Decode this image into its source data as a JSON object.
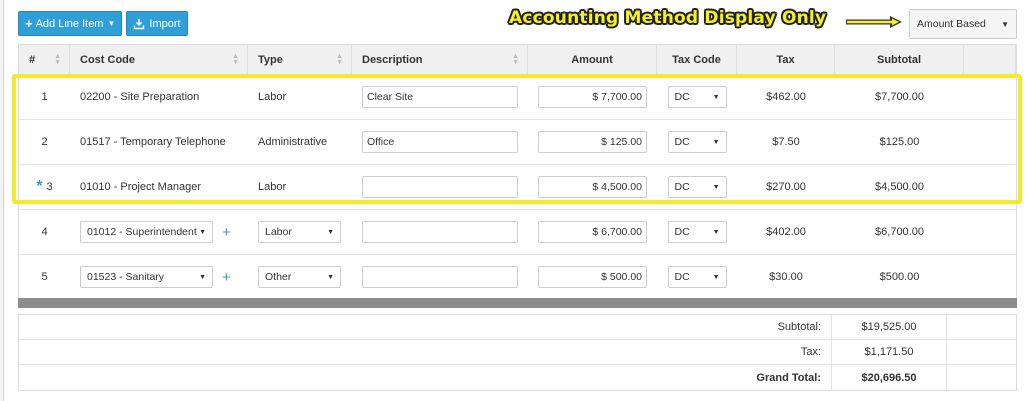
{
  "toolbar": {
    "add_line_item": "Add Line Item",
    "import": "Import"
  },
  "callout": {
    "text": "Accounting Method Display Only",
    "color": "#f5f02c"
  },
  "accounting_method": {
    "selected": "Amount Based"
  },
  "table": {
    "headers": [
      "#",
      "Cost Code",
      "Type",
      "Description",
      "Amount",
      "Tax Code",
      "Tax",
      "Subtotal"
    ],
    "rows": [
      {
        "num": "1",
        "cost_code": "02200 - Site Preparation",
        "type": "Labor",
        "description": "Clear Site",
        "amount": "$ 7,700.00",
        "tax_code": "DC",
        "tax": "$462.00",
        "subtotal": "$7,700.00"
      },
      {
        "num": "2",
        "cost_code": "01517 - Temporary Telephone",
        "type": "Administrative",
        "description": "Office",
        "amount": "$ 125.00",
        "tax_code": "DC",
        "tax": "$7.50",
        "subtotal": "$125.00"
      },
      {
        "num": "3",
        "cost_code": "01010 - Project Manager",
        "type": "Labor",
        "description": "",
        "amount": "$ 4,500.00",
        "tax_code": "DC",
        "tax": "$270.00",
        "subtotal": "$4,500.00",
        "marker": "*"
      },
      {
        "num": "4",
        "cost_code": "01012 - Superintendent",
        "type": "Labor",
        "description": "",
        "amount": "$ 6,700.00",
        "tax_code": "DC",
        "tax": "$402.00",
        "subtotal": "$6,700.00"
      },
      {
        "num": "5",
        "cost_code": "01523 - Sanitary",
        "type": "Other",
        "description": "",
        "amount": "$ 500.00",
        "tax_code": "DC",
        "tax": "$30.00",
        "subtotal": "$500.00"
      }
    ]
  },
  "totals": {
    "subtotal_label": "Subtotal:",
    "subtotal_value": "$19,525.00",
    "tax_label": "Tax:",
    "tax_value": "$1,171.50",
    "grand_total_label": "Grand Total:",
    "grand_total_value": "$20,696.50"
  },
  "colors": {
    "accent": "#2f9fd8",
    "highlight": "#f2ea2d"
  }
}
